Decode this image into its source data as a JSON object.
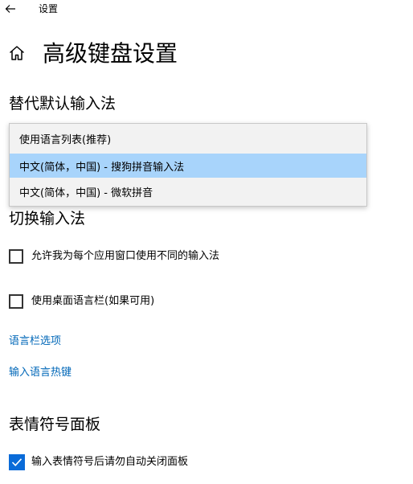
{
  "window": {
    "title": "设置"
  },
  "header": {
    "page_title": "高级键盘设置"
  },
  "override_input": {
    "section_title": "替代默认输入法",
    "options": [
      {
        "label": "使用语言列表(推荐)"
      },
      {
        "label": "中文(简体，中国) - 搜狗拼音输入法"
      },
      {
        "label": "中文(简体，中国) - 微软拼音"
      }
    ],
    "selected_index": 1
  },
  "switch_input": {
    "section_title": "切换输入法",
    "checkbox_per_app": {
      "label": "允许我为每个应用窗口使用不同的输入法",
      "checked": false
    },
    "checkbox_langbar": {
      "label": "使用桌面语言栏(如果可用)",
      "checked": false
    },
    "link_langbar_options": "语言栏选项",
    "link_hotkeys": "输入语言热键"
  },
  "emoji_panel": {
    "section_title": "表情符号面板",
    "checkbox_autoclose": {
      "label": "输入表情符号后请勿自动关闭面板",
      "checked": true
    }
  },
  "colors": {
    "accent": "#0a6bd8",
    "link": "#0067b8",
    "selected_option": "#a8d4fb"
  },
  "icons": {
    "back": "back-arrow-icon",
    "home": "home-icon",
    "check": "checkmark-icon"
  }
}
